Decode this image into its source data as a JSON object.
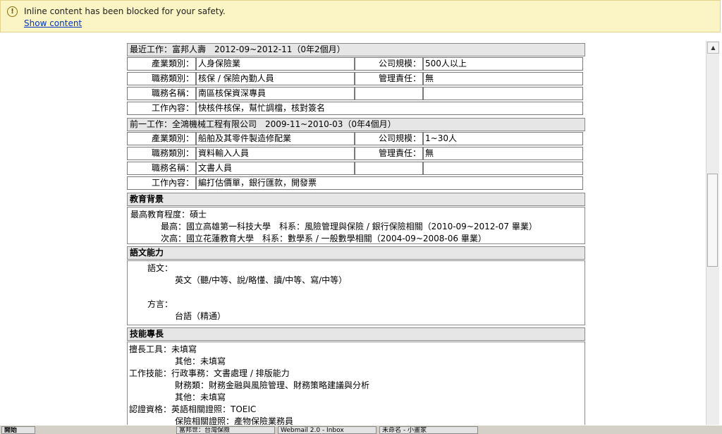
{
  "infobar": {
    "message": "Inline content has been blocked for your safety.",
    "link": "Show content"
  },
  "jobs": [
    {
      "title": "最近工作：富邦人壽　2012-09~2012-11（0年2個月）",
      "rows": [
        [
          "產業類別：",
          "人身保險業",
          "公司規模：",
          "500人以上"
        ],
        [
          "職務類別：",
          "核保 / 保險內勤人員",
          "管理責任：",
          "無"
        ],
        [
          "職務名稱：",
          "南區核保資深專員",
          "",
          ""
        ]
      ],
      "content_label": "工作內容：",
      "content": "快核件核保，幫忙調檔，核對簽名"
    },
    {
      "title": "前一工作：全鴻機械工程有限公司　2009-11~2010-03（0年4個月）",
      "rows": [
        [
          "產業類別：",
          "船舶及其零件製造修配業",
          "公司規模：",
          "1~30人"
        ],
        [
          "職務類別：",
          "資料輸入人員",
          "管理責任：",
          "無"
        ],
        [
          "職務名稱：",
          "文書人員",
          "",
          ""
        ]
      ],
      "content_label": "工作內容：",
      "content": "編打估價單，銀行匯款，開發票"
    }
  ],
  "education": {
    "title": "教育背景",
    "highest_level": "最高教育程度：碩士",
    "first": "最高：國立高雄第一科技大學　科系：風險管理與保險 / 銀行保險相關（2010-09~2012-07 畢業）",
    "second": "次高：國立花蓮教育大學　科系：數學系 / 一般數學相關（2004-09~2008-06 畢業）"
  },
  "language": {
    "title": "語文能力",
    "lang_label": "語文：",
    "lang_value": "英文（聽/中等、說/略懂、讀/中等、寫/中等）",
    "dialect_label": "方言：",
    "dialect_value": "台語（精通）"
  },
  "skills": {
    "title": "技能專長",
    "lines": [
      "擅長工具：未填寫",
      "其他：未填寫",
      "工作技能：行政事務：文書處理 / 排版能力",
      "財務類：財務金融與風險管理、財務策略建議與分析",
      "其他：未填寫",
      "認證資格：英語相關證照：TOEIC",
      "保險相關證照：產物保險業務員"
    ]
  },
  "taskbar": {
    "start": "開始",
    "items": [
      "富邦世：台灣保險",
      "Webmail 2.0 - Inbox",
      "未命名 - 小畫家"
    ]
  }
}
